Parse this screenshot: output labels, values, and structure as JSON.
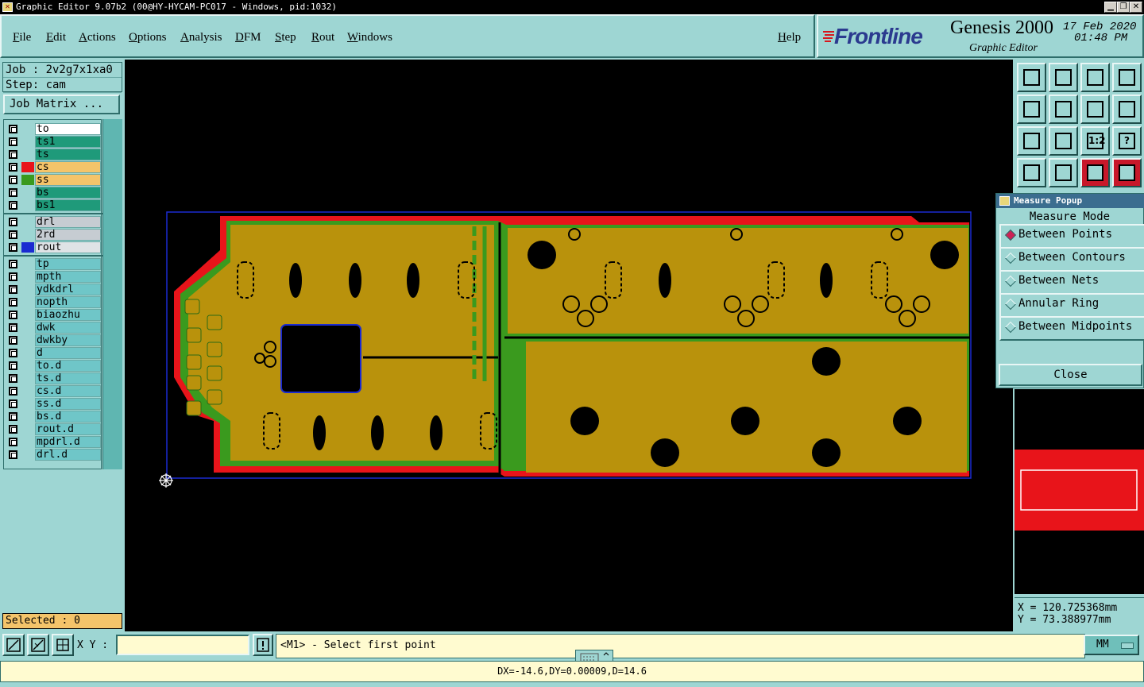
{
  "window": {
    "title": "Graphic Editor 9.07b2 (00@HY-HYCAM-PC017 - Windows, pid:1032)"
  },
  "menu": [
    "File",
    "Edit",
    "Actions",
    "Options",
    "Analysis",
    "DFM",
    "Step",
    "Rout",
    "Windows"
  ],
  "help_label": "Help",
  "logo": {
    "brand": "Frontline",
    "product": "Genesis 2000",
    "subtitle": "Graphic Editor",
    "date": "17 Feb 2020",
    "time": "01:48 PM"
  },
  "job": {
    "job_label": "Job : 2v2g7x1xa0",
    "step_label": "Step: cam",
    "matrix_button": "Job Matrix ..."
  },
  "layers": [
    {
      "name": "to",
      "bg": "#ffffff",
      "color": ""
    },
    {
      "name": "ts1",
      "bg": "#1f9a7a",
      "color": ""
    },
    {
      "name": "ts",
      "bg": "#1f9a7a",
      "color": ""
    },
    {
      "name": "cs",
      "bg": "#f4c46a",
      "color": "#e8141a"
    },
    {
      "name": "ss",
      "bg": "#f4c46a",
      "color": "#3a9a1e"
    },
    {
      "name": "bs",
      "bg": "#1f9a7a",
      "color": ""
    },
    {
      "name": "bs1",
      "bg": "#1f9a7a",
      "color": ""
    },
    {
      "name": "drl",
      "bg": "#c6ccd2",
      "color": ""
    },
    {
      "name": "2rd",
      "bg": "#c6ccd2",
      "color": ""
    },
    {
      "name": "rout",
      "bg": "#dfe3e6",
      "color": "#1b2bd1"
    },
    {
      "name": "tp",
      "bg": "#6fc6c8",
      "color": ""
    },
    {
      "name": "mpth",
      "bg": "#6fc6c8",
      "color": ""
    },
    {
      "name": "ydkdrl",
      "bg": "#6fc6c8",
      "color": ""
    },
    {
      "name": "nopth",
      "bg": "#6fc6c8",
      "color": ""
    },
    {
      "name": "biaozhu",
      "bg": "#6fc6c8",
      "color": ""
    },
    {
      "name": "dwk",
      "bg": "#6fc6c8",
      "color": ""
    },
    {
      "name": "dwkby",
      "bg": "#6fc6c8",
      "color": ""
    },
    {
      "name": "d",
      "bg": "#6fc6c8",
      "color": ""
    },
    {
      "name": "to.d",
      "bg": "#6fc6c8",
      "color": ""
    },
    {
      "name": "ts.d",
      "bg": "#6fc6c8",
      "color": ""
    },
    {
      "name": "cs.d",
      "bg": "#6fc6c8",
      "color": ""
    },
    {
      "name": "ss.d",
      "bg": "#6fc6c8",
      "color": ""
    },
    {
      "name": "bs.d",
      "bg": "#6fc6c8",
      "color": ""
    },
    {
      "name": "rout.d",
      "bg": "#6fc6c8",
      "color": ""
    },
    {
      "name": "mpdrl.d",
      "bg": "#6fc6c8",
      "color": ""
    },
    {
      "name": "drl.d",
      "bg": "#6fc6c8",
      "color": ""
    }
  ],
  "selected_label": "Selected : 0",
  "measure_popup": {
    "title": "Measure Popup",
    "mode_label": "Measure Mode",
    "options": [
      "Between Points",
      "Between Contours",
      "Between Nets",
      "Annular Ring",
      "Between Midpoints"
    ],
    "selected_option": "Between Points",
    "close_label": "Close"
  },
  "toolbar_icons": [
    "zoom-home-icon",
    "zoom-in-icon",
    "home-icon",
    "window-icon",
    "pan-left-icon",
    "pan-right-icon",
    "undo-view-icon",
    "redraw-icon",
    "fit-icon",
    "center-icon",
    "scale-1to2-icon",
    "query-icon",
    "settings-icon",
    "snap-icon",
    "net-icon",
    "net-highlight-icon"
  ],
  "toolbar_text": {
    "scale": "1:2",
    "query": "?"
  },
  "coords": {
    "x": "X = 120.725368mm",
    "y": "Y = 73.388977mm"
  },
  "status": {
    "xy_label": "X Y :",
    "xy_value": "",
    "prompt": "<M1> - Select first point",
    "units": "MM"
  },
  "measurement_result": "DX=-14.6,DY=0.00009,D=14.6",
  "colors": {
    "panel": "#9ed6d3",
    "copper": "#b9920c",
    "green": "#3a9a1e",
    "red": "#e8141a",
    "blue": "#1b2bd1"
  }
}
